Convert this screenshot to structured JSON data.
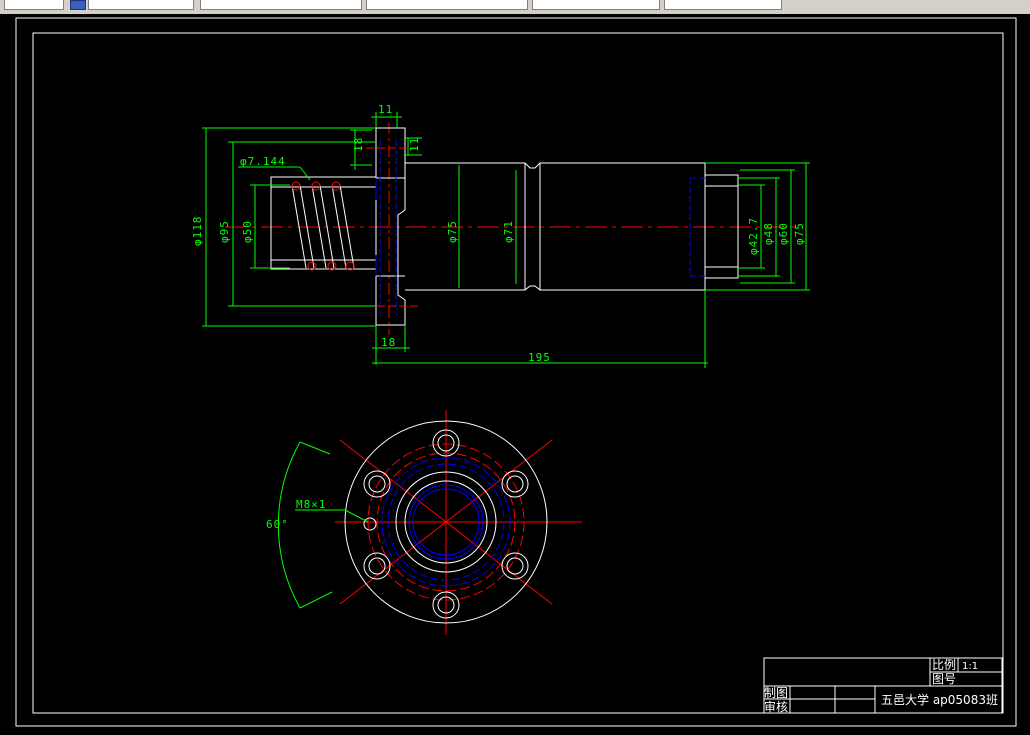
{
  "toolbar": {
    "fields": [
      "",
      "",
      "",
      "",
      ""
    ]
  },
  "drawing": {
    "side_view": {
      "dims": {
        "top_width": "11",
        "flange_inner_h1": "18",
        "flange_inner_h2": "11",
        "thread_dia": "φ7.144",
        "outer_left": "φ118",
        "dia95": "φ95",
        "dia50": "φ50",
        "dia75_mid": "φ75",
        "dia71": "φ71",
        "dia42": "φ42.7",
        "dia48": "φ48",
        "dia60": "φ60",
        "dia75_right": "φ75",
        "flange_width": "18",
        "total_length": "195"
      }
    },
    "front_view": {
      "hole_label": "M8×1",
      "angle_label": "60°"
    },
    "title_block": {
      "scale_label": "比例",
      "scale_value": "1:1",
      "drawing_no_label": "图号",
      "drawn_by": "制图",
      "checked_by": "审核",
      "school": "五邑大学 ap05083班"
    },
    "colors": {
      "outline": "#ffffff",
      "dimension": "#00ff00",
      "centerline": "#ff0000",
      "hidden": "#0000ff"
    }
  }
}
